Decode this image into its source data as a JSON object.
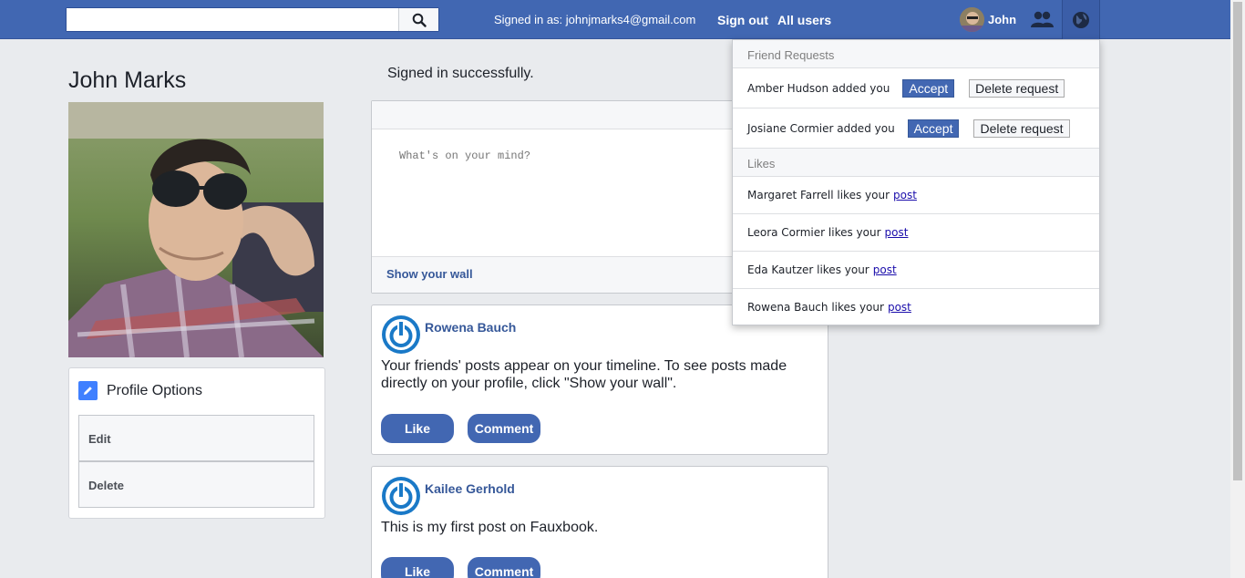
{
  "header": {
    "search": {
      "value": "",
      "placeholder": ""
    },
    "signed_in_text": "Signed in as: johnjmarks4@gmail.com",
    "sign_out": "Sign out",
    "all_users": "All users",
    "user_name": "John",
    "icons": [
      "search-icon",
      "friends-icon",
      "globe-icon"
    ],
    "bar_color": "#4167b2"
  },
  "profile": {
    "name": "John Marks",
    "options_title": "Profile Options",
    "options": [
      "Edit",
      "Delete"
    ]
  },
  "main": {
    "flash": "Signed in successfully.",
    "composer_placeholder": "What's on your mind?",
    "show_wall": "Show your wall",
    "posts": [
      {
        "author": "Rowena Bauch",
        "body": "Your friends' posts appear on your timeline. To see posts made directly on your profile, click \"Show your wall\".",
        "like": "Like",
        "comment": "Comment"
      },
      {
        "author": "Kailee Gerhold",
        "body": "This is my first post on Fauxbook.",
        "like": "Like",
        "comment": "Comment"
      }
    ]
  },
  "notifications": {
    "friend_requests_title": "Friend Requests",
    "requests": [
      {
        "text": "Amber Hudson added you",
        "accept": "Accept",
        "delete": "Delete request"
      },
      {
        "text": "Josiane Cormier added you",
        "accept": "Accept",
        "delete": "Delete request"
      }
    ],
    "likes_title": "Likes",
    "likes": [
      {
        "text": "Margaret Farrell likes your",
        "link": "post"
      },
      {
        "text": "Leora Cormier likes your",
        "link": "post"
      },
      {
        "text": "Eda Kautzer likes your",
        "link": "post"
      },
      {
        "text": "Rowena Bauch likes your",
        "link": "post"
      }
    ]
  }
}
